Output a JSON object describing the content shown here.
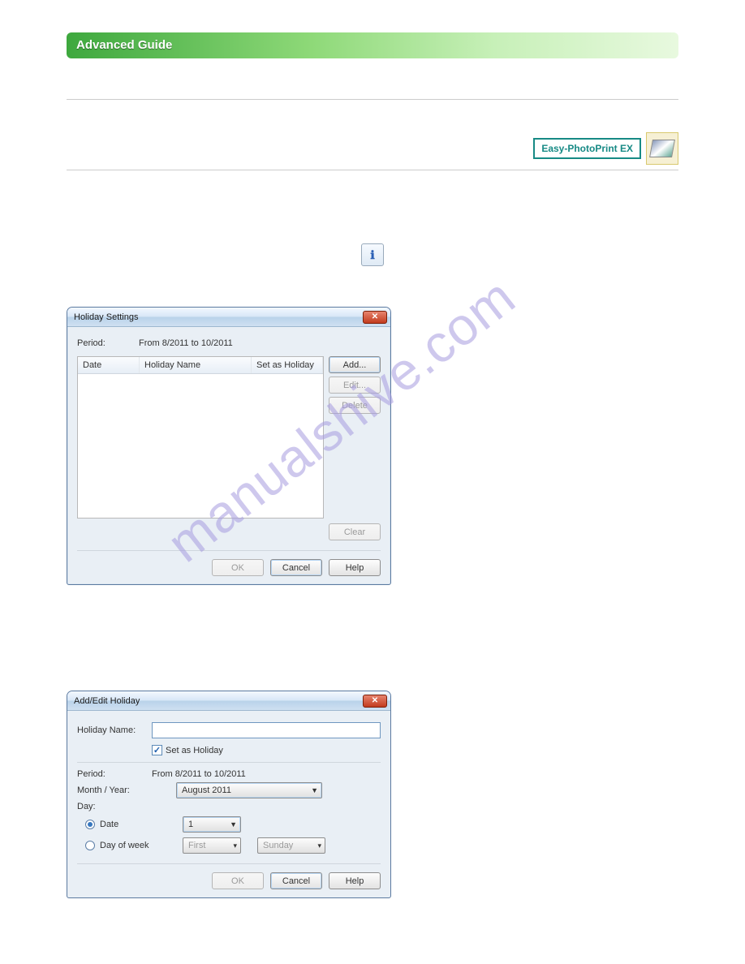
{
  "banner": {
    "title": "Advanced Guide"
  },
  "epp": {
    "label": "Easy-PhotoPrint EX"
  },
  "watermark": "manualshive.com",
  "dlg1": {
    "title": "Holiday Settings",
    "period_label": "Period:",
    "period_value": "From 8/2011 to 10/2011",
    "cols": {
      "date": "Date",
      "name": "Holiday Name",
      "set": "Set as Holiday"
    },
    "buttons": {
      "add": "Add...",
      "edit": "Edit...",
      "del": "Delete",
      "clear": "Clear",
      "ok": "OK",
      "cancel": "Cancel",
      "help": "Help"
    }
  },
  "dlg2": {
    "title": "Add/Edit Holiday",
    "name_label": "Holiday Name:",
    "chk_label": "Set as Holiday",
    "chk_checked": true,
    "period_label": "Period:",
    "period_value": "From 8/2011 to 10/2011",
    "month_label": "Month / Year:",
    "month_value": "August 2011",
    "day_label": "Day:",
    "radio_date_label": "Date",
    "radio_date_value": "1",
    "radio_dow_label": "Day of week",
    "dow_ord": "First",
    "dow_day": "Sunday",
    "buttons": {
      "ok": "OK",
      "cancel": "Cancel",
      "help": "Help"
    }
  }
}
